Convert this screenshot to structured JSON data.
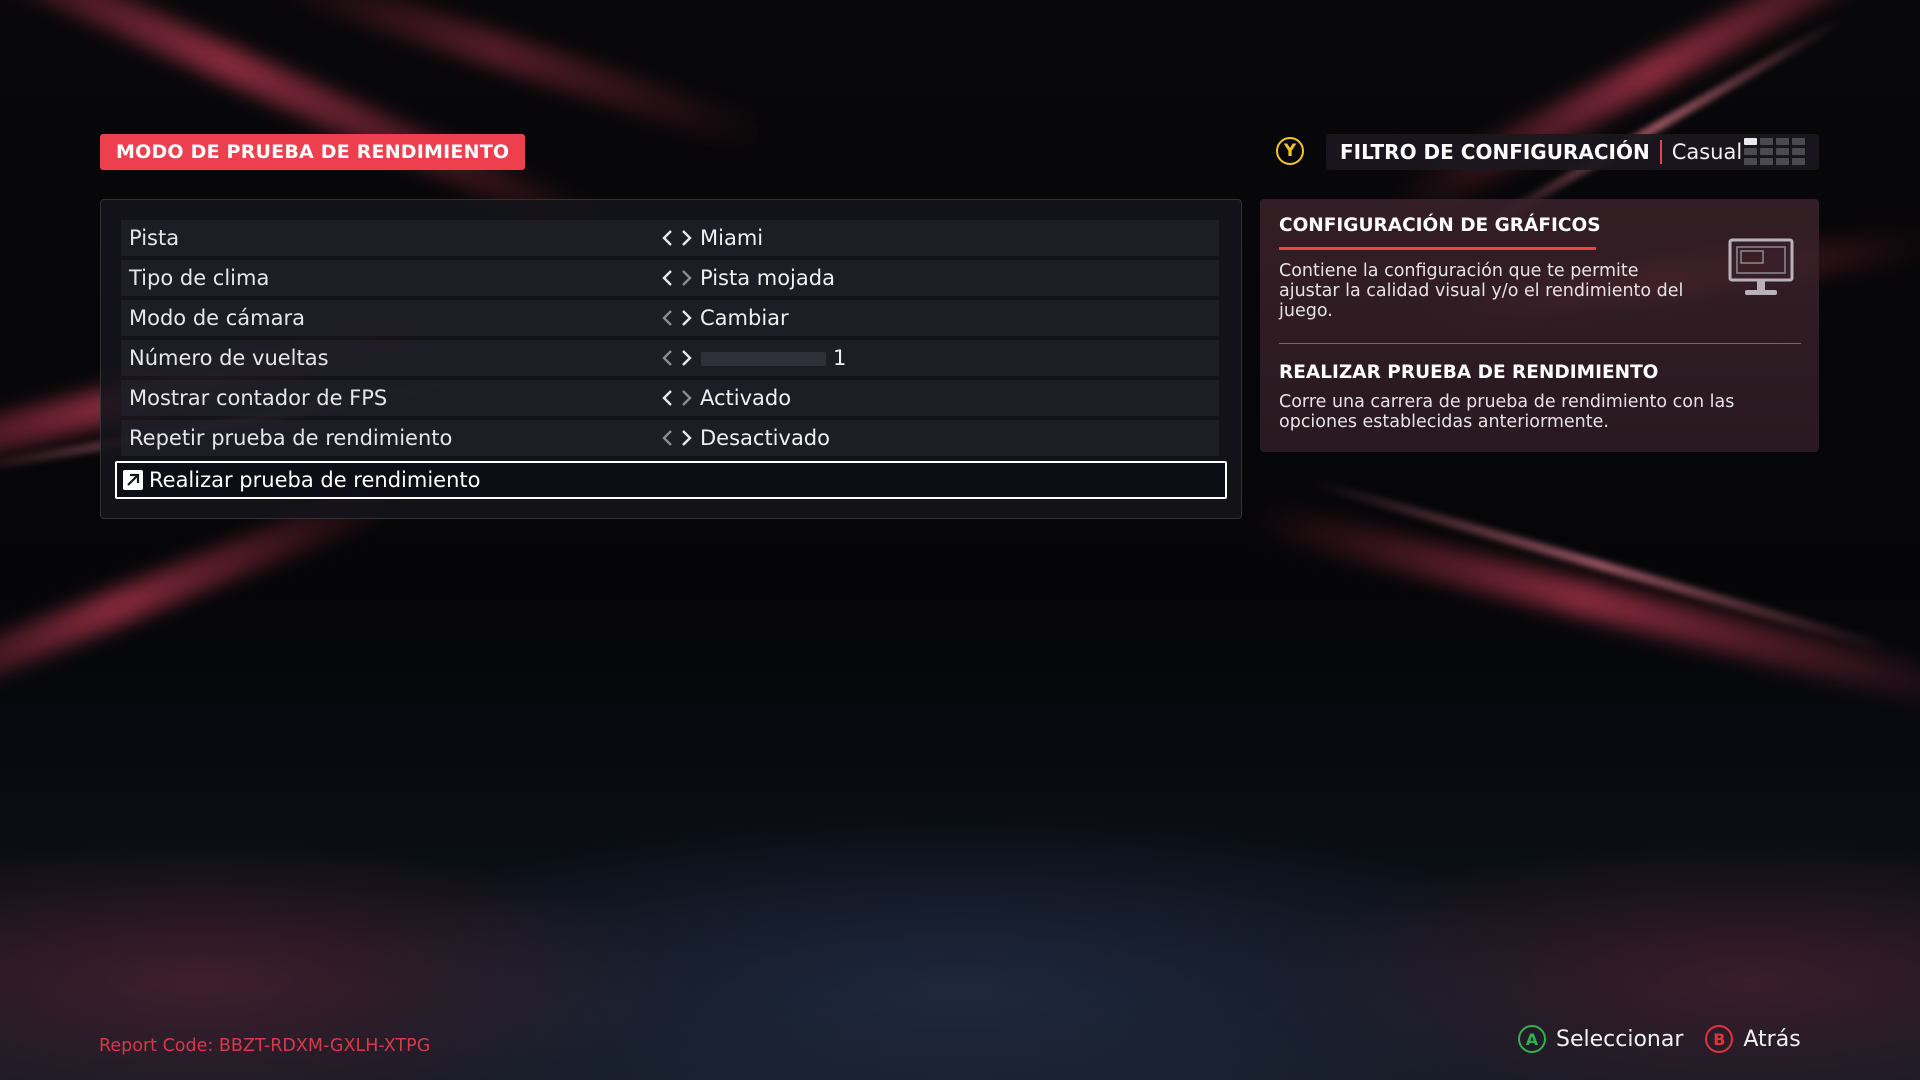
{
  "header": {
    "title": "MODO DE PRUEBA DE RENDIMIENTO",
    "filter_button": "Y",
    "filter_label": "FILTRO DE CONFIGURACIÓN",
    "filter_value": "Casual"
  },
  "settings": [
    {
      "label": "Pista",
      "value": "Miami"
    },
    {
      "label": "Tipo de clima",
      "value": "Pista mojada"
    },
    {
      "label": "Modo de cámara",
      "value": "Cambiar"
    },
    {
      "label": "Número de vueltas",
      "value": "1"
    },
    {
      "label": "Mostrar contador de FPS",
      "value": "Activado"
    },
    {
      "label": "Repetir prueba de rendimiento",
      "value": "Desactivado"
    }
  ],
  "action": {
    "label": "Realizar prueba de rendimiento"
  },
  "info": {
    "section1_title": "CONFIGURACIÓN DE GRÁFICOS",
    "section1_desc": "Contiene la configuración que te permite ajustar la calidad visual y/o el rendimiento del juego.",
    "section2_title": "REALIZAR PRUEBA DE RENDIMIENTO",
    "section2_desc": "Corre una carrera de prueba de rendimiento con las opciones establecidas anteriormente."
  },
  "footer": {
    "report_code": "Report Code: BBZT-RDXM-GXLH-XTPG",
    "select_button": "A",
    "select_label": "Seleccionar",
    "back_button": "B",
    "back_label": "Atrás"
  },
  "colors": {
    "accent": "#ee3f4f",
    "y_button": "#f2c628",
    "a_button": "#2fb34a",
    "b_button": "#e2333d"
  },
  "icons": [
    "left-arrow-icon",
    "right-arrow-icon",
    "external-link-icon",
    "monitor-icon",
    "filter-grid-icon"
  ]
}
